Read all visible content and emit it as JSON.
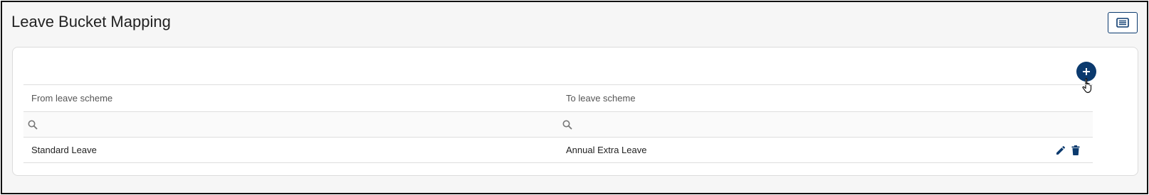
{
  "page": {
    "title": "Leave Bucket Mapping"
  },
  "toolbar": {
    "view_toggle_icon": "list-view-icon"
  },
  "card": {
    "add_icon": "plus-icon"
  },
  "table": {
    "columns": [
      "From leave scheme",
      "To leave scheme"
    ],
    "filters": [
      {
        "placeholder": "",
        "icon": "search-icon"
      },
      {
        "placeholder": "",
        "icon": "search-icon"
      }
    ],
    "rows": [
      {
        "from": "Standard Leave",
        "to": "Annual Extra Leave",
        "actions": [
          "edit-icon",
          "delete-icon"
        ]
      }
    ]
  },
  "colors": {
    "primary": "#0b3a6e",
    "background": "#f6f6f6",
    "border": "#dedede"
  }
}
